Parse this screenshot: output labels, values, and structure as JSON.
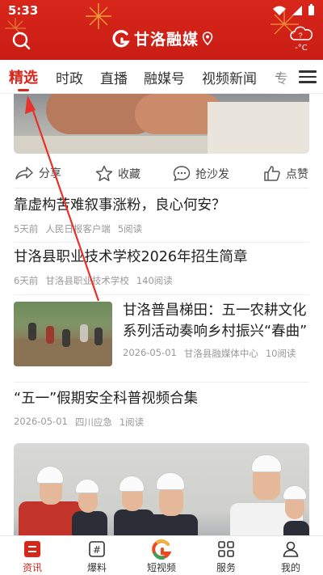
{
  "status": {
    "time": "5:33"
  },
  "header": {
    "title": "甘洛融媒",
    "weather_temp": "-°C",
    "weather_symbol": "?"
  },
  "tabs": [
    {
      "label": "精选",
      "active": true
    },
    {
      "label": "时政"
    },
    {
      "label": "直播"
    },
    {
      "label": "融媒号"
    },
    {
      "label": "视频新闻"
    },
    {
      "label": "专"
    }
  ],
  "actions": {
    "share": "分享",
    "favorite": "收藏",
    "comment": "抢沙发",
    "like": "点赞"
  },
  "articles": [
    {
      "title": "靠虚构苦难叙事涨粉，良心何安？",
      "date": "5天前",
      "source": "人民日报客户端",
      "reads": "5阅读"
    },
    {
      "title": "甘洛县职业技术学校2026年招生简章",
      "date": "6天前",
      "source": "甘洛县职业技术学校",
      "reads": "140阅读"
    },
    {
      "title": "甘洛普昌梯田：五一农耕文化系列活动奏响乡村振兴“春曲”",
      "date": "2026-05-01",
      "source": "甘洛县融媒体中心",
      "reads": "10阅读"
    },
    {
      "title": "“五一”假期安全科普视频合集",
      "date": "2026-05-01",
      "source": "四川应急",
      "reads": "1阅读"
    }
  ],
  "bottom_nav": [
    {
      "label": "资讯",
      "icon": "news-icon",
      "active": true
    },
    {
      "label": "爆料",
      "icon": "tipoff-icon"
    },
    {
      "label": "短视频",
      "icon": "short-video-logo-icon"
    },
    {
      "label": "服务",
      "icon": "grid-icon"
    },
    {
      "label": "我的",
      "icon": "profile-icon"
    }
  ],
  "colors": {
    "brand": "#d8261b",
    "meta_text": "#999999"
  }
}
